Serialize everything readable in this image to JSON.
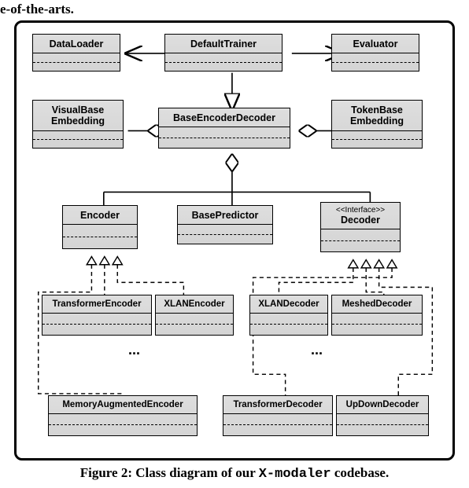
{
  "top_fragment": "e-of-the-arts.",
  "classes": {
    "dataloader": "DataLoader",
    "defaulttrainer": "DefaultTrainer",
    "evaluator": "Evaluator",
    "visualbase": "VisualBase\nEmbedding",
    "baseencdec": "BaseEncoderDecoder",
    "tokenbase": "TokenBase\nEmbedding",
    "encoder": "Encoder",
    "basepredictor": "BasePredictor",
    "decoder_stereo": "<<Interface>>",
    "decoder": "Decoder",
    "transformerenc": "TransformerEncoder",
    "xlanenc": "XLANEncoder",
    "xlandec": "XLANDecoder",
    "mesheddec": "MeshedDecoder",
    "memaugenc": "MemoryAugmentedEncoder",
    "transformerdec": "TransformerDecoder",
    "updowndec": "UpDownDecoder"
  },
  "ellipsis": "...",
  "caption_prefix": "Figure 2: Class diagram of our ",
  "caption_code": "X-modaler",
  "caption_suffix": " codebase."
}
